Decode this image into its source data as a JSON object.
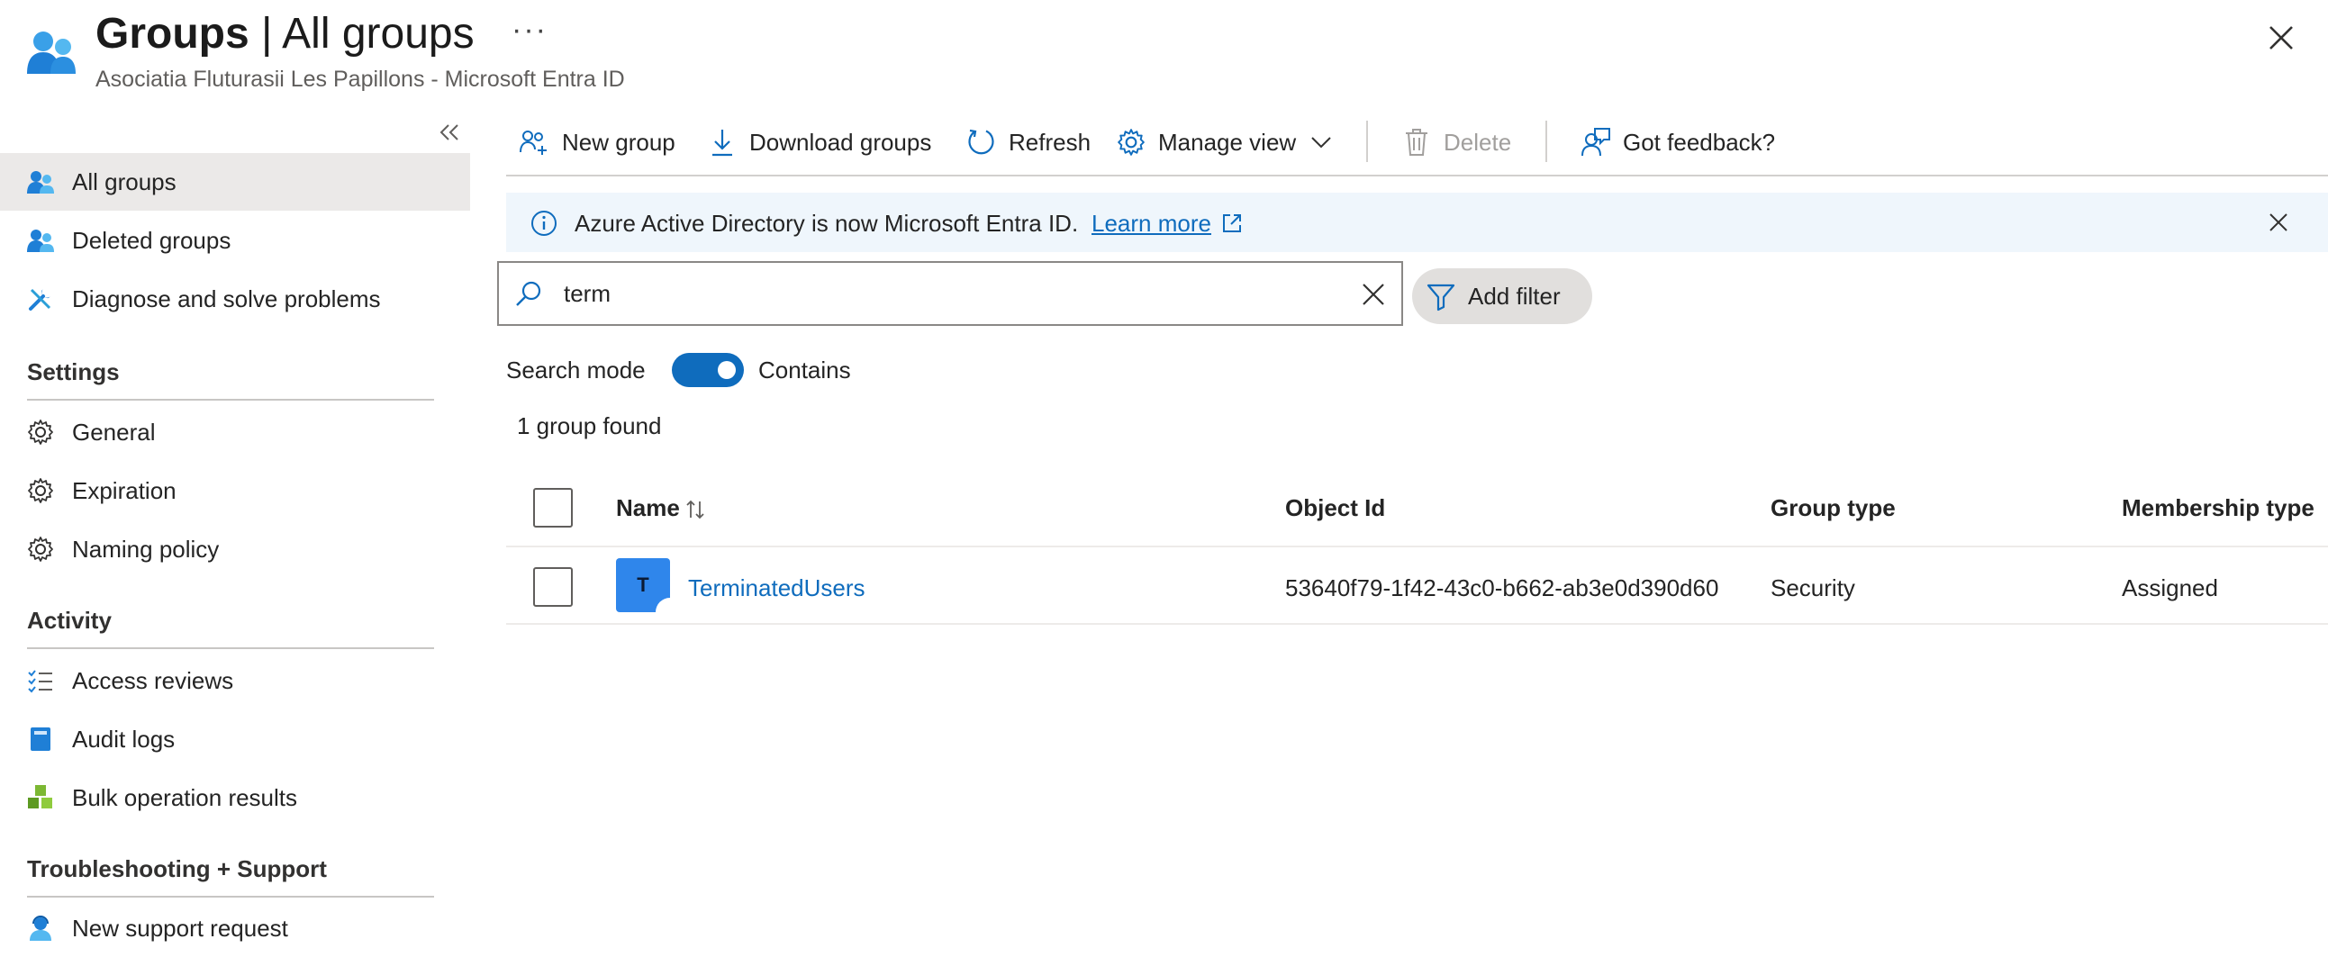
{
  "header": {
    "title_bold": "Groups",
    "title_rest": " | All groups",
    "more": "···",
    "subtitle": "Asociatia Fluturasii Les Papillons - Microsoft Entra ID"
  },
  "sidebar": {
    "top_items": [
      {
        "label": "All groups",
        "icon": "group-icon",
        "active": true
      },
      {
        "label": "Deleted groups",
        "icon": "group-icon"
      },
      {
        "label": "Diagnose and solve problems",
        "icon": "wrench-icon"
      }
    ],
    "sections": [
      {
        "title": "Settings",
        "items": [
          {
            "label": "General",
            "icon": "gear-icon"
          },
          {
            "label": "Expiration",
            "icon": "gear-icon"
          },
          {
            "label": "Naming policy",
            "icon": "gear-icon"
          }
        ]
      },
      {
        "title": "Activity",
        "items": [
          {
            "label": "Access reviews",
            "icon": "checklist-icon"
          },
          {
            "label": "Audit logs",
            "icon": "book-icon"
          },
          {
            "label": "Bulk operation results",
            "icon": "cubes-icon"
          }
        ]
      },
      {
        "title": "Troubleshooting + Support",
        "items": [
          {
            "label": "New support request",
            "icon": "support-person-icon"
          }
        ]
      }
    ]
  },
  "toolbar": {
    "new_group": "New group",
    "download_groups": "Download groups",
    "refresh": "Refresh",
    "manage_view": "Manage view",
    "delete": "Delete",
    "feedback": "Got feedback?"
  },
  "banner": {
    "text": "Azure Active Directory is now Microsoft Entra ID.",
    "link": "Learn more"
  },
  "search": {
    "value": "term",
    "add_filter": "Add filter",
    "mode_label": "Search mode",
    "mode_value": "Contains",
    "mode_on": true,
    "result_count": "1 group found"
  },
  "table": {
    "columns": [
      "Name",
      "Object Id",
      "Group type",
      "Membership type"
    ],
    "rows": [
      {
        "initial": "T",
        "name": "TerminatedUsers",
        "object_id": "53640f79-1f42-43c0-b662-ab3e0d390d60",
        "group_type": "Security",
        "membership_type": "Assigned"
      }
    ]
  },
  "colors": {
    "accent": "#0f6cbd",
    "avatar": "#2f86eb",
    "active_nav": "#ebe9e8",
    "banner_bg": "#eff6fc"
  }
}
